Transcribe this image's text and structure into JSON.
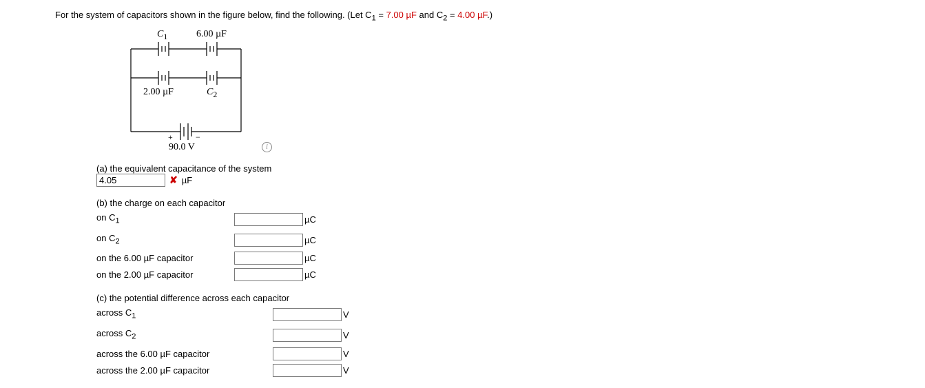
{
  "prompt": {
    "pre": "For the system of capacitors shown in the figure below, find the following. (Let C",
    "sub1": "1",
    "mid1": " = ",
    "c1_val": "7.00 µF",
    "mid2": " and C",
    "sub2": "2",
    "mid3": " = ",
    "c2_val": "4.00 µF",
    "post": ".)"
  },
  "figure_labels": {
    "C1": "C",
    "C1_sub": "1",
    "top_right": "6.00 µF",
    "bottom_left": "2.00 µF",
    "C2": "C",
    "C2_sub": "2",
    "plus": "+",
    "minus": "−",
    "voltage": "90.0 V"
  },
  "part_a": {
    "title": "(a) the equivalent capacitance of the system",
    "answer_value": "4.05",
    "wrong_mark": "✘",
    "unit": "µF"
  },
  "part_b": {
    "title": "(b) the charge on each capacitor",
    "rows": [
      {
        "label_pre": "on C",
        "label_sub": "1",
        "label_post": "",
        "unit": "µC"
      },
      {
        "label_pre": "on C",
        "label_sub": "2",
        "label_post": "",
        "unit": "µC"
      },
      {
        "label_pre": "on the 6.00 µF capacitor",
        "label_sub": "",
        "label_post": "",
        "unit": "µC"
      },
      {
        "label_pre": "on the 2.00 µF capacitor",
        "label_sub": "",
        "label_post": "",
        "unit": "µC"
      }
    ]
  },
  "part_c": {
    "title": "(c) the potential difference across each capacitor",
    "rows": [
      {
        "label_pre": "across C",
        "label_sub": "1",
        "label_post": "",
        "unit": "V"
      },
      {
        "label_pre": "across C",
        "label_sub": "2",
        "label_post": "",
        "unit": "V"
      },
      {
        "label_pre": "across the 6.00 µF capacitor",
        "label_sub": "",
        "label_post": "",
        "unit": "V"
      },
      {
        "label_pre": "across the 2.00 µF capacitor",
        "label_sub": "",
        "label_post": "",
        "unit": "V"
      }
    ]
  }
}
